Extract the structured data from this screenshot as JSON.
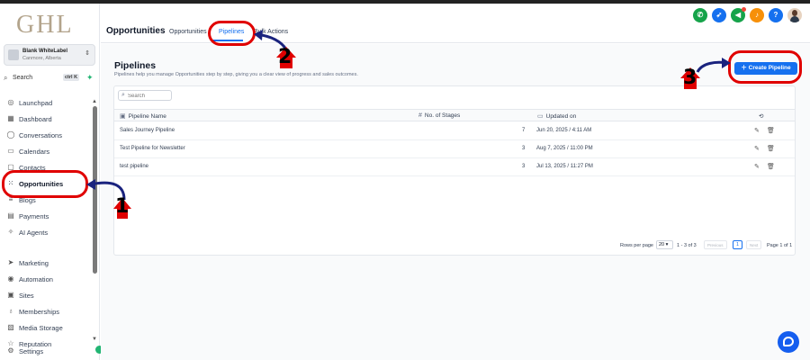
{
  "brand": {
    "logo_text": "GHL"
  },
  "account": {
    "name": "Blank WhiteLabel",
    "location": "Canmore, Alberta"
  },
  "search": {
    "label": "Search",
    "shortcut": "ctrl K"
  },
  "sidebar": {
    "items": [
      {
        "label": "Launchpad",
        "icon": "rocket-icon"
      },
      {
        "label": "Dashboard",
        "icon": "dashboard-icon"
      },
      {
        "label": "Conversations",
        "icon": "chat-icon"
      },
      {
        "label": "Calendars",
        "icon": "calendar-icon"
      },
      {
        "label": "Contacts",
        "icon": "contacts-icon"
      },
      {
        "label": "Opportunities",
        "icon": "opportunities-icon",
        "active": true
      },
      {
        "label": "Blogs",
        "icon": "blog-icon"
      },
      {
        "label": "Payments",
        "icon": "payments-icon"
      },
      {
        "label": "AI Agents",
        "icon": "ai-agents-icon"
      },
      {
        "label": "Marketing",
        "icon": "marketing-icon"
      },
      {
        "label": "Automation",
        "icon": "automation-icon"
      },
      {
        "label": "Sites",
        "icon": "sites-icon"
      },
      {
        "label": "Memberships",
        "icon": "memberships-icon"
      },
      {
        "label": "Media Storage",
        "icon": "media-icon"
      },
      {
        "label": "Reputation",
        "icon": "reputation-icon"
      },
      {
        "label": "Settings",
        "icon": "gear-icon"
      }
    ]
  },
  "header": {
    "title": "Opportunities",
    "tabs": [
      {
        "label": "Opportunities"
      },
      {
        "label": "Pipelines",
        "active": true
      },
      {
        "label": "Bulk Actions"
      }
    ],
    "icons": [
      {
        "name": "phone-icon",
        "color": "#16a34a"
      },
      {
        "name": "launch-icon",
        "color": "#1570ef"
      },
      {
        "name": "megaphone-icon",
        "color": "#16a34a"
      },
      {
        "name": "bell-icon",
        "color": "#f79009"
      },
      {
        "name": "help-icon",
        "color": "#1570ef",
        "glyph": "?"
      }
    ]
  },
  "page": {
    "title": "Pipelines",
    "subtitle": "Pipelines help you manage Opportunities step by step, giving you a clear view of progress and sales outcomes.",
    "create_label": "Create Pipeline",
    "search_placeholder": "Search"
  },
  "table": {
    "columns": [
      "Pipeline Name",
      "No. of Stages",
      "Updated on"
    ],
    "rows": [
      {
        "name": "Sales Journey Pipeline",
        "stages": "7",
        "updated": "Jun 20, 2025 / 4:11 AM"
      },
      {
        "name": "Test Pipeline for Newsletter",
        "stages": "3",
        "updated": "Aug 7, 2025 / 11:00 PM"
      },
      {
        "name": "test pipeline",
        "stages": "3",
        "updated": "Jul 13, 2025 / 11:27 PM"
      }
    ]
  },
  "pagination": {
    "rows_per_page_label": "Rows per page",
    "rows_per_page": "20",
    "range": "1 - 3 of 3",
    "previous": "Previous",
    "page": "1",
    "next": "Next",
    "page_of": "Page 1 of 1"
  },
  "annotations": {
    "one": "1",
    "two": "2",
    "three": "3"
  },
  "colors": {
    "accent": "#1570ef",
    "annotation": "#e00000",
    "logo": "#b3a48c"
  }
}
